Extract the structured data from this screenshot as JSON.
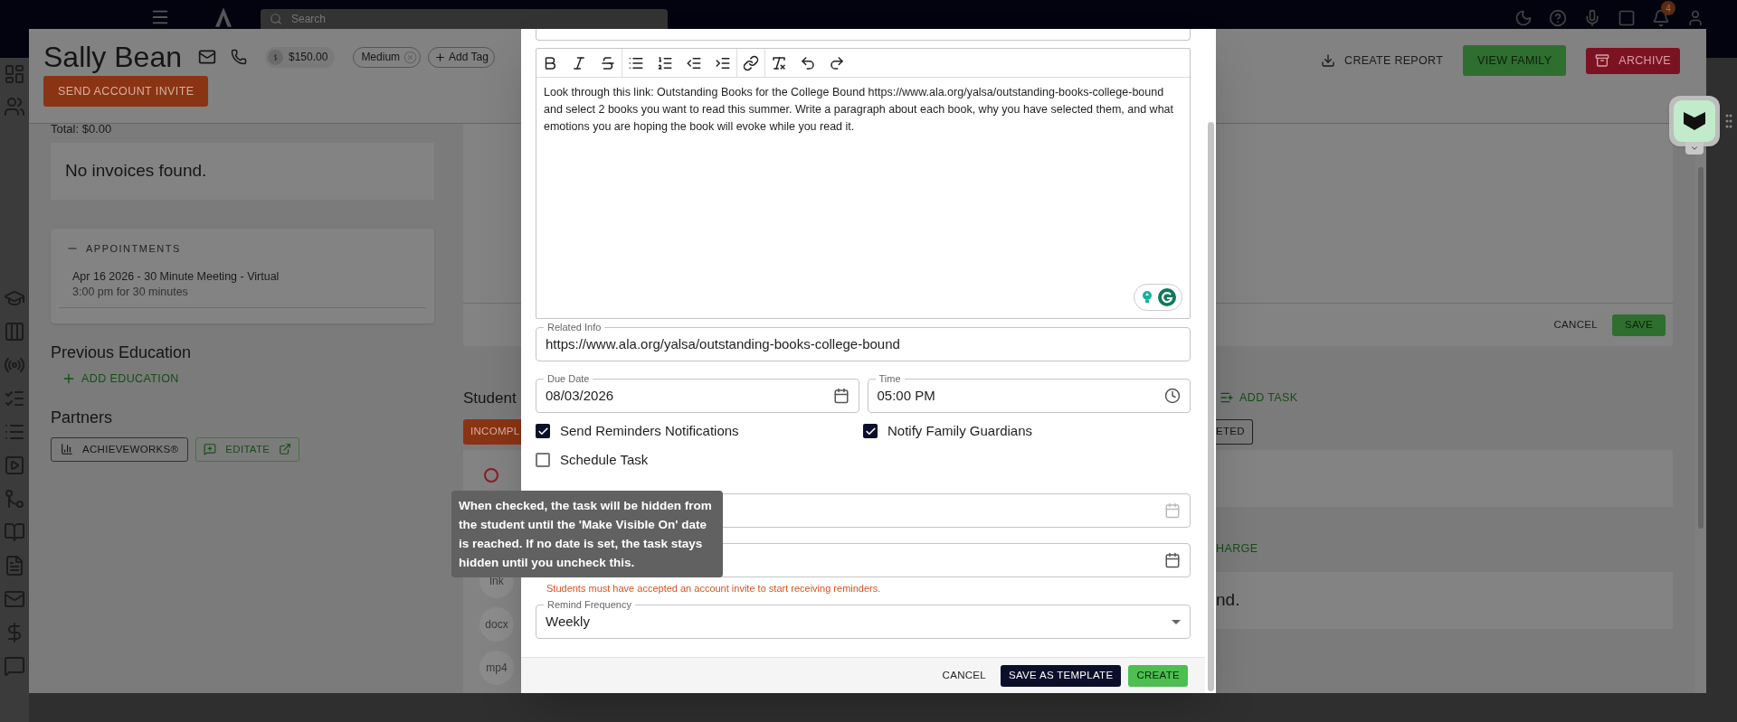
{
  "app_bar": {
    "search": {
      "placeholder": "Search"
    },
    "notification_count": "4"
  },
  "profile": {
    "name": "Sally Bean",
    "balance": "$150.00",
    "tags": [
      {
        "label": "Medium"
      }
    ],
    "add_tag": "Add Tag",
    "invite_button": "SEND ACCOUNT INVITE",
    "actions": [
      {
        "kind": "report",
        "label": "CREATE REPORT"
      },
      {
        "kind": "family",
        "label": "VIEW FAMILY"
      },
      {
        "kind": "archive",
        "label": "ARCHIVE"
      }
    ]
  },
  "invoices": {
    "total": "Total: $0.00",
    "empty": "No invoices found."
  },
  "appointments": {
    "title": "APPOINTMENTS",
    "expanded": true,
    "items": [
      {
        "title": "Apr 16 2026 - 30 Minute Meeting - Virtual",
        "time": "3:00 pm for 30 minutes"
      }
    ]
  },
  "previous_education": {
    "title": "Previous Education",
    "add_button": "ADD EDUCATION"
  },
  "partners": {
    "title": "Partners",
    "items": [
      {
        "kind": "chart",
        "label": "ACHIEVEWORKS®"
      },
      {
        "kind": "external",
        "label": "EDITATE"
      }
    ]
  },
  "edit_card": {
    "buttons": [
      {
        "kind": "text",
        "label": "CANCEL"
      },
      {
        "kind": "save",
        "label": "SAVE"
      }
    ]
  },
  "tasks": {
    "title": "Student",
    "add_button": "ADD TASK",
    "filters": [
      {
        "label": "INCOMPL",
        "selected": true
      },
      {
        "label": "ETED",
        "selected": false
      }
    ],
    "files": [
      "lnk",
      "docx",
      "mp4"
    ]
  },
  "charges": {
    "add_button": "HARGE",
    "empty": "nd."
  },
  "task_dialog": {
    "description": "Look through this link: Outstanding Books for the College Bound https://www.ala.org/yalsa/outstanding-books-college-bound and select 2 books you want to read this summer. Write a paragraph about each book, why you have selected them, and what emotions you are hoping the book will evoke while you read it.",
    "related_info": {
      "label": "Related Info",
      "value": "https://www.ala.org/yalsa/outstanding-books-college-bound"
    },
    "due_date": {
      "label": "Due Date",
      "value": "08/03/2026"
    },
    "time": {
      "label": "Time",
      "value": "05:00 PM"
    },
    "options": [
      {
        "label": "Send Reminders Notifications",
        "checked": true
      },
      {
        "label": "Notify Family Guardians",
        "checked": true
      },
      {
        "label": "Schedule Task",
        "checked": false
      }
    ],
    "reminder_note": "Students must have accepted an account invite to start receiving reminders.",
    "remind_frequency": {
      "label": "Remind Frequency",
      "value": "Weekly"
    },
    "buttons": [
      {
        "kind": "text",
        "label": "CANCEL"
      },
      {
        "kind": "secondary",
        "label": "SAVE AS TEMPLATE"
      },
      {
        "kind": "primary",
        "label": "CREATE"
      }
    ]
  },
  "tooltip": {
    "text": "When checked, the task will be hidden from the student until the 'Make Visible On' date is reached. If no date is set, the task stays hidden until you uncheck this."
  }
}
